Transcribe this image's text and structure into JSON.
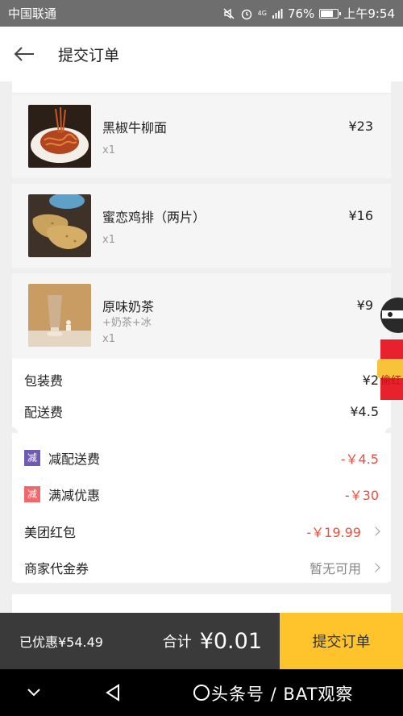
{
  "status": {
    "carrier": "中国联通",
    "signal_label": "4G",
    "battery": "76%",
    "time": "上午9:54",
    "battery_level": 0.76
  },
  "header": {
    "title": "提交订单"
  },
  "items": [
    {
      "name": "黑椒牛柳面",
      "price": "¥23",
      "qty": "x1",
      "extra": ""
    },
    {
      "name": "蜜恋鸡排（两片）",
      "price": "¥16",
      "qty": "x1",
      "extra": ""
    },
    {
      "name": "原味奶茶",
      "price": "¥9",
      "qty": "x1",
      "extra": "+奶茶+冰"
    }
  ],
  "fees": {
    "packaging_label": "包装费",
    "packaging_value": "¥2",
    "delivery_label": "配送费",
    "delivery_value": "¥4.5"
  },
  "discounts": {
    "tag": "减",
    "delivery_discount_label": "减配送费",
    "delivery_discount_value": "-￥4.5",
    "full_reduction_label": "满减优惠",
    "full_reduction_value": "-￥30",
    "redpacket_label": "美团红包",
    "redpacket_value": "-￥19.99",
    "voucher_label": "商家代金券",
    "voucher_value": "暂无可用"
  },
  "floater": {
    "text": "偷红"
  },
  "bottom": {
    "saved": "已优惠¥54.49",
    "total_label": "合计",
    "total_value": "¥0.01",
    "submit_label": "提交订单"
  },
  "watermark": "头条号 / BAT观察",
  "colors": {
    "accent": "#ffc42b",
    "red": "#f04d3a",
    "tag_purple": "#6f5bb5",
    "tag_red": "#f0686a"
  }
}
